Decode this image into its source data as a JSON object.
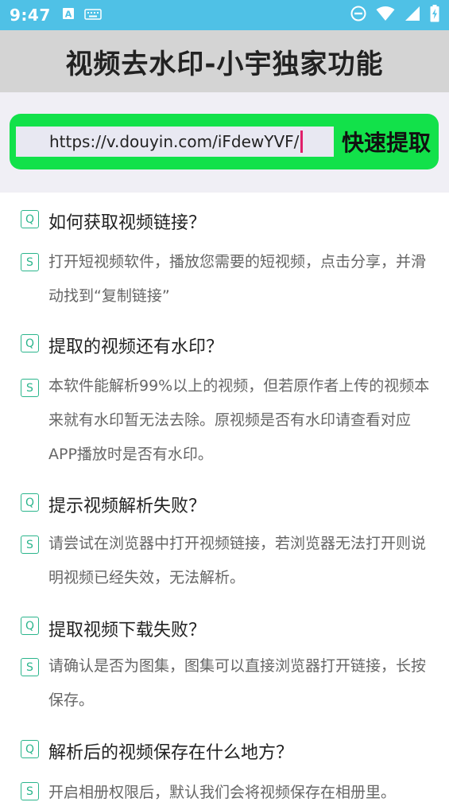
{
  "status_bar": {
    "time": "9:47",
    "left_icons": [
      "keyboard-a-icon",
      "keyboard-icon"
    ],
    "right_icons": [
      "do-not-disturb-icon",
      "wifi-icon",
      "signal-icon",
      "battery-charging-icon"
    ]
  },
  "header": {
    "title": "视频去水印-小宇独家功能"
  },
  "url_bar": {
    "value": "https://v.douyin.com/iFdewYVF/",
    "extract_label": "快速提取"
  },
  "faq": [
    {
      "q_badge": "Q",
      "a_badge": "S",
      "question": "如何获取视频链接？",
      "answer": "打开短视频软件，播放您需要的短视频，点击分享，并滑动找到“复制链接”"
    },
    {
      "q_badge": "Q",
      "a_badge": "S",
      "question": "提取的视频还有水印？",
      "answer": "本软件能解析99%以上的视频，但若原作者上传的视频本来就有水印暂无法去除。原视频是否有水印请查看对应APP播放时是否有水印。"
    },
    {
      "q_badge": "Q",
      "a_badge": "S",
      "question": "提示视频解析失败？",
      "answer": "请尝试在浏览器中打开视频链接，若浏览器无法打开则说明视频已经失效，无法解析。"
    },
    {
      "q_badge": "Q",
      "a_badge": "S",
      "question": "提取视频下载失败？",
      "answer": "请确认是否为图集，图集可以直接浏览器打开链接，长按保存。"
    },
    {
      "q_badge": "Q",
      "a_badge": "S",
      "question": "解析后的视频保存在什么地方？",
      "answer": "开启相册权限后，默认我们会将视频保存在相册里。"
    }
  ]
}
